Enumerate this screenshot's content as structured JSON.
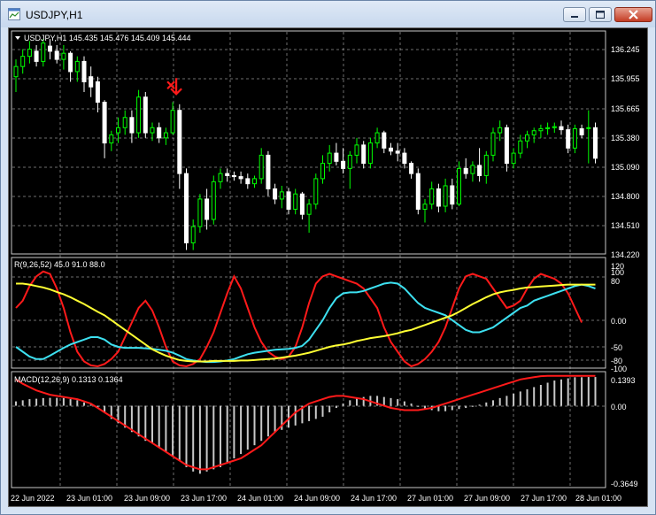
{
  "window": {
    "title": "USDJPY,H1"
  },
  "icons": {
    "app": "chart-window-icon",
    "minimize": "minimize-icon",
    "maximize": "maximize-icon",
    "close": "close-icon",
    "arrow": "sell-arrow-icon",
    "collapse": "triangle-down-icon"
  },
  "colors": {
    "background": "#000000",
    "bull_candle": "#00ff00",
    "bear_candle": "#ffffff",
    "grid": "#c8c8c8",
    "rvi_red": "#ff1a1a",
    "rvi_cyan": "#3de0f0",
    "rvi_yellow": "#ffff33",
    "macd_hist": "#c8c8c8",
    "macd_signal": "#ff1a1a",
    "arrow": "#ff1a1a"
  },
  "price_pane": {
    "label": "USDJPY,H1  145.435 145.476 145.409 145.444",
    "y_labels": [
      "136.245",
      "135.955",
      "135.665",
      "135.380",
      "135.090",
      "134.800",
      "134.510",
      "134.220"
    ]
  },
  "rvi_pane": {
    "label": "R(9,26,52) 45.0 91.0 88.0",
    "y_labels": [
      "120",
      "100",
      "80",
      "0.00",
      "-50",
      "-80",
      "-100"
    ]
  },
  "macd_pane": {
    "label": "MACD(12,26,9) 0.1313 0.1364",
    "y_labels": [
      "0.1393",
      "0.00",
      "-0.3649"
    ]
  },
  "x_labels": [
    "22 Jun 2022",
    "23 Jun 01:00",
    "23 Jun 09:00",
    "23 Jun 17:00",
    "24 Jun 01:00",
    "24 Jun 09:00",
    "24 Jun 17:00",
    "27 Jun 01:00",
    "27 Jun 09:00",
    "27 Jun 17:00",
    "28 Jun 01:00"
  ],
  "chart_data": [
    {
      "type": "candlestick",
      "title": "USDJPY,H1",
      "ylim": [
        134.22,
        136.39
      ],
      "y_ticks": [
        136.245,
        135.955,
        135.665,
        135.38,
        135.09,
        134.8,
        134.51,
        134.22
      ],
      "ohlc": [
        [
          135.95,
          136.12,
          135.8,
          136.05
        ],
        [
          136.05,
          136.22,
          135.98,
          136.15
        ],
        [
          136.15,
          136.3,
          136.08,
          136.22
        ],
        [
          136.2,
          136.26,
          136.05,
          136.1
        ],
        [
          136.1,
          136.32,
          136.05,
          136.28
        ],
        [
          136.25,
          136.32,
          136.12,
          136.2
        ],
        [
          136.2,
          136.26,
          136.08,
          136.12
        ],
        [
          136.12,
          136.26,
          136.02,
          136.18
        ],
        [
          136.18,
          136.2,
          135.9,
          136.0
        ],
        [
          136.0,
          136.15,
          135.9,
          136.1
        ],
        [
          136.1,
          136.15,
          135.8,
          135.9
        ],
        [
          135.95,
          136.05,
          135.75,
          135.85
        ],
        [
          135.9,
          135.95,
          135.6,
          135.7
        ],
        [
          135.7,
          135.72,
          135.15,
          135.3
        ],
        [
          135.3,
          135.42,
          135.22,
          135.38
        ],
        [
          135.4,
          135.55,
          135.3,
          135.45
        ],
        [
          135.45,
          135.62,
          135.38,
          135.55
        ],
        [
          135.55,
          135.62,
          135.3,
          135.4
        ],
        [
          135.4,
          135.82,
          135.35,
          135.75
        ],
        [
          135.75,
          135.8,
          135.35,
          135.4
        ],
        [
          135.4,
          135.5,
          135.32,
          135.45
        ],
        [
          135.45,
          135.5,
          135.3,
          135.35
        ],
        [
          135.35,
          135.45,
          135.28,
          135.4
        ],
        [
          135.4,
          135.7,
          135.38,
          135.62
        ],
        [
          135.62,
          135.68,
          134.85,
          135.0
        ],
        [
          135.0,
          135.05,
          134.25,
          134.32
        ],
        [
          134.32,
          134.55,
          134.25,
          134.48
        ],
        [
          134.48,
          134.8,
          134.42,
          134.75
        ],
        [
          134.75,
          134.85,
          134.45,
          134.55
        ],
        [
          134.55,
          134.98,
          134.5,
          134.92
        ],
        [
          134.92,
          135.05,
          134.85,
          135.0
        ],
        [
          135.0,
          135.05,
          134.92,
          134.98
        ],
        [
          134.98,
          135.02,
          134.93,
          134.97
        ],
        [
          134.97,
          135.02,
          134.9,
          134.95
        ],
        [
          134.95,
          135.0,
          134.85,
          134.9
        ],
        [
          134.9,
          134.98,
          134.86,
          134.95
        ],
        [
          134.95,
          135.25,
          134.9,
          135.18
        ],
        [
          135.18,
          135.22,
          134.78,
          134.85
        ],
        [
          134.85,
          134.9,
          134.7,
          134.75
        ],
        [
          134.75,
          134.88,
          134.66,
          134.82
        ],
        [
          134.82,
          134.86,
          134.6,
          134.65
        ],
        [
          134.65,
          134.85,
          134.6,
          134.8
        ],
        [
          134.8,
          134.82,
          134.55,
          134.6
        ],
        [
          134.6,
          134.75,
          134.42,
          134.7
        ],
        [
          134.7,
          135.0,
          134.65,
          134.95
        ],
        [
          134.95,
          135.18,
          134.9,
          135.1
        ],
        [
          135.1,
          135.28,
          135.02,
          135.2
        ],
        [
          135.2,
          135.3,
          135.08,
          135.12
        ],
        [
          135.12,
          135.25,
          135.0,
          135.05
        ],
        [
          135.05,
          135.22,
          134.85,
          135.18
        ],
        [
          135.18,
          135.35,
          135.1,
          135.28
        ],
        [
          135.28,
          135.32,
          135.05,
          135.1
        ],
        [
          135.1,
          135.35,
          135.05,
          135.3
        ],
        [
          135.3,
          135.45,
          135.25,
          135.4
        ],
        [
          135.4,
          135.42,
          135.2,
          135.25
        ],
        [
          135.25,
          135.3,
          135.18,
          135.22
        ],
        [
          135.22,
          135.3,
          135.12,
          135.2
        ],
        [
          135.2,
          135.25,
          135.05,
          135.1
        ],
        [
          135.1,
          135.12,
          134.95,
          135.0
        ],
        [
          135.0,
          135.05,
          134.6,
          134.65
        ],
        [
          134.65,
          134.75,
          134.52,
          134.7
        ],
        [
          134.7,
          134.92,
          134.65,
          134.85
        ],
        [
          134.85,
          134.9,
          134.62,
          134.68
        ],
        [
          134.68,
          134.95,
          134.62,
          134.88
        ],
        [
          134.88,
          134.95,
          134.65,
          134.7
        ],
        [
          134.7,
          135.12,
          134.68,
          135.05
        ],
        [
          135.05,
          135.15,
          134.95,
          135.0
        ],
        [
          135.0,
          135.12,
          134.92,
          135.08
        ],
        [
          135.08,
          135.25,
          134.92,
          134.98
        ],
        [
          134.98,
          135.22,
          134.9,
          135.18
        ],
        [
          135.18,
          135.45,
          135.12,
          135.4
        ],
        [
          135.4,
          135.52,
          135.32,
          135.45
        ],
        [
          135.45,
          135.48,
          135.02,
          135.1
        ],
        [
          135.1,
          135.25,
          135.05,
          135.2
        ],
        [
          135.2,
          135.38,
          135.15,
          135.32
        ],
        [
          135.32,
          135.42,
          135.25,
          135.38
        ],
        [
          135.38,
          135.45,
          135.3,
          135.42
        ],
        [
          135.42,
          135.48,
          135.35,
          135.44
        ],
        [
          135.44,
          135.5,
          135.38,
          135.45
        ],
        [
          135.45,
          135.5,
          135.4,
          135.46
        ],
        [
          135.46,
          135.52,
          135.38,
          135.43
        ],
        [
          135.43,
          135.48,
          135.2,
          135.25
        ],
        [
          135.25,
          135.48,
          135.2,
          135.44
        ],
        [
          135.44,
          135.48,
          135.35,
          135.38
        ],
        [
          135.45,
          135.62,
          135.1,
          135.45
        ],
        [
          135.45,
          135.5,
          135.1,
          135.15
        ]
      ],
      "annotation": {
        "type": "sell-arrow",
        "x_index": 23,
        "price": 135.78
      }
    },
    {
      "type": "line",
      "title": "R(9,26,52)",
      "ylim": [
        -100,
        120
      ],
      "series": [
        {
          "name": "R9",
          "values": [
            20,
            35,
            65,
            85,
            95,
            90,
            60,
            20,
            -30,
            -70,
            -90,
            -98,
            -100,
            -95,
            -85,
            -70,
            -40,
            -10,
            20,
            35,
            15,
            -20,
            -60,
            -90,
            -98,
            -100,
            -95,
            -85,
            -60,
            -30,
            10,
            50,
            85,
            60,
            20,
            -20,
            -50,
            -70,
            -80,
            -85,
            -80,
            -60,
            -20,
            30,
            70,
            85,
            90,
            85,
            80,
            75,
            70,
            60,
            40,
            20,
            -20,
            -50,
            -70,
            -90,
            -100,
            -95,
            -85,
            -70,
            -50,
            -20,
            20,
            60,
            85,
            90,
            85,
            80,
            60,
            40,
            20,
            25,
            35,
            60,
            80,
            90,
            85,
            80,
            70,
            50,
            20,
            -10
          ]
        },
        {
          "name": "R26",
          "values": [
            -60,
            -70,
            -80,
            -85,
            -85,
            -78,
            -70,
            -62,
            -55,
            -50,
            -45,
            -40,
            -40,
            -45,
            -55,
            -60,
            -62,
            -62,
            -62,
            -63,
            -64,
            -66,
            -68,
            -72,
            -78,
            -85,
            -88,
            -90,
            -91,
            -91,
            -90,
            -88,
            -85,
            -80,
            -75,
            -72,
            -70,
            -68,
            -66,
            -65,
            -64,
            -62,
            -58,
            -45,
            -25,
            -5,
            20,
            40,
            50,
            52,
            52,
            55,
            60,
            65,
            70,
            72,
            70,
            60,
            45,
            30,
            20,
            15,
            10,
            5,
            -5,
            -15,
            -25,
            -30,
            -30,
            -25,
            -20,
            -10,
            0,
            10,
            20,
            25,
            35,
            40,
            45,
            50,
            55,
            60,
            65,
            68,
            65,
            60
          ]
        },
        {
          "name": "R52",
          "values": [
            70,
            70,
            68,
            65,
            62,
            58,
            53,
            48,
            42,
            35,
            28,
            20,
            12,
            5,
            -5,
            -15,
            -25,
            -35,
            -45,
            -55,
            -65,
            -72,
            -78,
            -83,
            -87,
            -89,
            -90,
            -90,
            -90,
            -89,
            -89,
            -89,
            -89,
            -88,
            -88,
            -87,
            -86,
            -85,
            -84,
            -82,
            -80,
            -78,
            -75,
            -72,
            -68,
            -64,
            -60,
            -57,
            -55,
            -52,
            -48,
            -45,
            -42,
            -40,
            -38,
            -35,
            -32,
            -28,
            -25,
            -20,
            -15,
            -10,
            -5,
            0,
            5,
            12,
            20,
            28,
            35,
            42,
            48,
            52,
            55,
            57,
            60,
            62,
            63,
            64,
            65,
            66,
            67,
            68,
            68,
            68,
            68,
            68
          ]
        }
      ]
    },
    {
      "type": "bar",
      "title": "MACD(12,26,9)",
      "ylim": [
        -0.3649,
        0.1393
      ],
      "series": [
        {
          "name": "MACD",
          "values": [
            0.02,
            0.025,
            0.03,
            0.032,
            0.035,
            0.036,
            0.036,
            0.035,
            0.03,
            0.025,
            0.015,
            0.005,
            -0.01,
            -0.03,
            -0.06,
            -0.08,
            -0.1,
            -0.12,
            -0.14,
            -0.16,
            -0.17,
            -0.19,
            -0.21,
            -0.23,
            -0.25,
            -0.28,
            -0.3,
            -0.31,
            -0.3,
            -0.29,
            -0.28,
            -0.26,
            -0.24,
            -0.22,
            -0.2,
            -0.18,
            -0.16,
            -0.14,
            -0.12,
            -0.11,
            -0.1,
            -0.09,
            -0.08,
            -0.07,
            -0.06,
            -0.05,
            -0.03,
            -0.01,
            0.01,
            0.025,
            0.035,
            0.04,
            0.045,
            0.045,
            0.04,
            0.035,
            0.03,
            0.02,
            0.01,
            -0.005,
            -0.015,
            -0.02,
            -0.025,
            -0.025,
            -0.02,
            -0.015,
            -0.01,
            -0.005,
            0.005,
            0.015,
            0.025,
            0.035,
            0.045,
            0.055,
            0.065,
            0.075,
            0.085,
            0.095,
            0.105,
            0.115,
            0.12,
            0.125,
            0.13,
            0.13,
            0.131,
            0.131
          ]
        },
        {
          "name": "Signal",
          "values": [
            0.12,
            0.1,
            0.085,
            0.07,
            0.06,
            0.05,
            0.045,
            0.04,
            0.035,
            0.03,
            0.02,
            0.01,
            -0.01,
            -0.03,
            -0.05,
            -0.07,
            -0.09,
            -0.11,
            -0.13,
            -0.15,
            -0.17,
            -0.19,
            -0.21,
            -0.23,
            -0.25,
            -0.27,
            -0.28,
            -0.29,
            -0.29,
            -0.28,
            -0.27,
            -0.26,
            -0.25,
            -0.24,
            -0.22,
            -0.2,
            -0.18,
            -0.15,
            -0.12,
            -0.09,
            -0.06,
            -0.03,
            -0.01,
            0.01,
            0.02,
            0.03,
            0.04,
            0.045,
            0.045,
            0.04,
            0.035,
            0.03,
            0.02,
            0.01,
            0.0,
            -0.01,
            -0.015,
            -0.02,
            -0.02,
            -0.02,
            -0.015,
            -0.01,
            0.0,
            0.01,
            0.02,
            0.03,
            0.04,
            0.05,
            0.06,
            0.07,
            0.08,
            0.09,
            0.1,
            0.11,
            0.12,
            0.125,
            0.13,
            0.135,
            0.136,
            0.136,
            0.136,
            0.136,
            0.136,
            0.136,
            0.136,
            0.136
          ]
        }
      ]
    }
  ]
}
